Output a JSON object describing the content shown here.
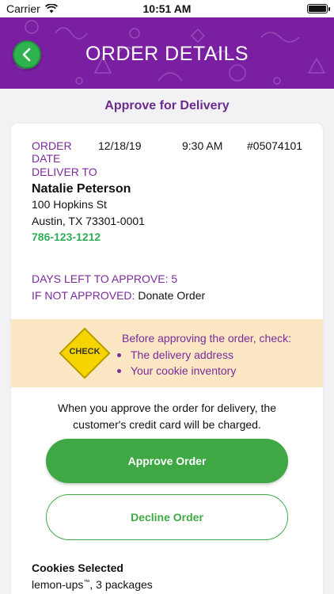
{
  "status_bar": {
    "carrier": "Carrier",
    "time": "10:51 AM"
  },
  "header": {
    "title": "ORDER DETAILS",
    "color": "#7b1fa2",
    "back_icon": "chevron-left-icon"
  },
  "subheader": {
    "title": "Approve for Delivery"
  },
  "order": {
    "date_label": "ORDER DATE",
    "date": "12/18/19",
    "time": "9:30 AM",
    "number": "#05074101"
  },
  "delivery": {
    "label": "DELIVER TO",
    "name": "Natalie Peterson",
    "address_line1": "100 Hopkins St",
    "address_line2": "Austin, TX 73301-0001",
    "phone": "786-123-1212"
  },
  "approval": {
    "days_left_label": "DAYS LEFT TO APPROVE:",
    "days_left_value": "5",
    "if_not_label": "IF NOT APPROVED:",
    "if_not_value": "Donate Order"
  },
  "checklist": {
    "sign_text": "CHECK",
    "title": "Before approving the order, check:",
    "items": [
      "The delivery address",
      "Your cookie inventory"
    ]
  },
  "charge_notice": {
    "line1": "When you approve the order for delivery, the",
    "line2": "customer's credit card will be charged."
  },
  "actions": {
    "approve_label": "Approve Order",
    "decline_label": "Decline Order"
  },
  "cookies": {
    "title": "Cookies Selected",
    "item_name": "lemon-ups",
    "item_mark": "™",
    "item_qty": ", 3 packages"
  }
}
